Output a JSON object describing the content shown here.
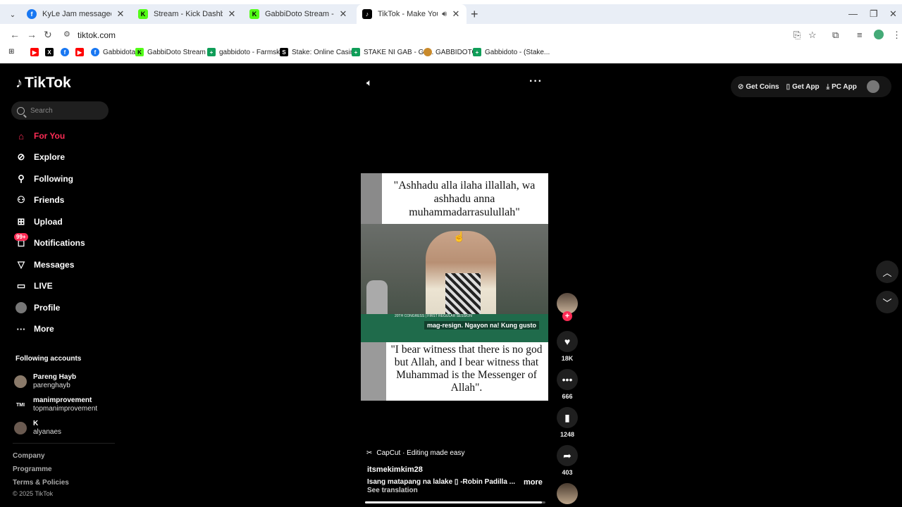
{
  "browser": {
    "tabs": [
      {
        "title": "KyLe Jam messaged KKYS",
        "favicon": "facebook-icon",
        "color": "#1877f2"
      },
      {
        "title": "Stream - Kick Dashboard",
        "favicon": "kick-icon",
        "color": "#53fc18"
      },
      {
        "title": "GabbiDoto Stream - Watch Live",
        "favicon": "kick-icon",
        "color": "#53fc18"
      },
      {
        "title": "TikTok - Make Your Day",
        "favicon": "tiktok-icon",
        "color": "#000000"
      }
    ],
    "url": "tiktok.com",
    "bookmarks": [
      {
        "label": "",
        "icon": "youtube-icon",
        "color": "#ff0000"
      },
      {
        "label": "",
        "icon": "x-icon",
        "color": "#000000"
      },
      {
        "label": "",
        "icon": "facebook-icon",
        "color": "#1877f2"
      },
      {
        "label": "",
        "icon": "youtube-icon",
        "color": "#ff0000"
      },
      {
        "label": "Gabbidota",
        "icon": "facebook-icon",
        "color": "#1877f2"
      },
      {
        "label": "GabbiDoto Stream -...",
        "icon": "kick-icon",
        "color": "#53fc18"
      },
      {
        "label": "gabbidoto - Farmski...",
        "icon": "sheets-icon",
        "color": "#0f9d58"
      },
      {
        "label": "Stake: Online Casin...",
        "icon": "stake-icon",
        "color": "#000000"
      },
      {
        "label": "STAKE NI GAB - Go...",
        "icon": "sheets-icon",
        "color": "#0f9d58"
      },
      {
        "label": "GABBIDOTO",
        "icon": "avatar-icon",
        "color": "#c98a2b"
      },
      {
        "label": "Gabbidoto - (Stake...",
        "icon": "sheets-icon",
        "color": "#0f9d58"
      }
    ]
  },
  "tiktok": {
    "logo": "TikTok",
    "search_placeholder": "Search",
    "nav": [
      {
        "label": "For You",
        "icon": "home-icon",
        "active": true
      },
      {
        "label": "Explore",
        "icon": "compass-icon"
      },
      {
        "label": "Following",
        "icon": "user-follow-icon"
      },
      {
        "label": "Friends",
        "icon": "friends-icon"
      },
      {
        "label": "Upload",
        "icon": "upload-icon"
      },
      {
        "label": "Notifications",
        "icon": "bell-icon",
        "badge": "99+"
      },
      {
        "label": "Messages",
        "icon": "send-icon"
      },
      {
        "label": "LIVE",
        "icon": "live-icon"
      },
      {
        "label": "Profile",
        "icon": "avatar-icon"
      },
      {
        "label": "More",
        "icon": "more-icon"
      }
    ],
    "following_title": "Following accounts",
    "following": [
      {
        "name": "Pareng Hayb",
        "handle": "parenghayb",
        "avatar": ""
      },
      {
        "name": "manimprovement",
        "handle": "topmanimprovement",
        "avatar": "TMI"
      },
      {
        "name": "K",
        "handle": "alyanaes",
        "avatar": ""
      }
    ],
    "footer": [
      "Company",
      "Programme",
      "Terms & Policies"
    ],
    "copyright": "© 2025 TikTok",
    "top_actions": [
      {
        "label": "Get Coins",
        "icon": "coin-icon"
      },
      {
        "label": "Get App",
        "icon": "phone-icon"
      },
      {
        "label": "PC App",
        "icon": "download-icon"
      }
    ],
    "video": {
      "caption_top": "\"Ashhadu alla ilaha illallah, wa ashhadu anna muhammadarrasulullah\"",
      "lower_third": "mag-resign. Ngayon na! Kung gusto",
      "lower_small": "20TH CONGRESS | FIRST REGULAR SESSION",
      "caption_bottom": "\"I bear witness that there is no god but Allah, and I bear witness that Muhammad is the Messenger of Allah\"."
    },
    "actions": {
      "likes": "18K",
      "comments": "666",
      "saves": "1248",
      "shares": "403"
    },
    "capcut": "CapCut · Editing made easy",
    "author": "itsmekimkim28",
    "description": "Isang matapang na lalake ▯ -Robin Padilla ...",
    "more": "more",
    "see_translation": "See translation",
    "progress": 0.98
  }
}
